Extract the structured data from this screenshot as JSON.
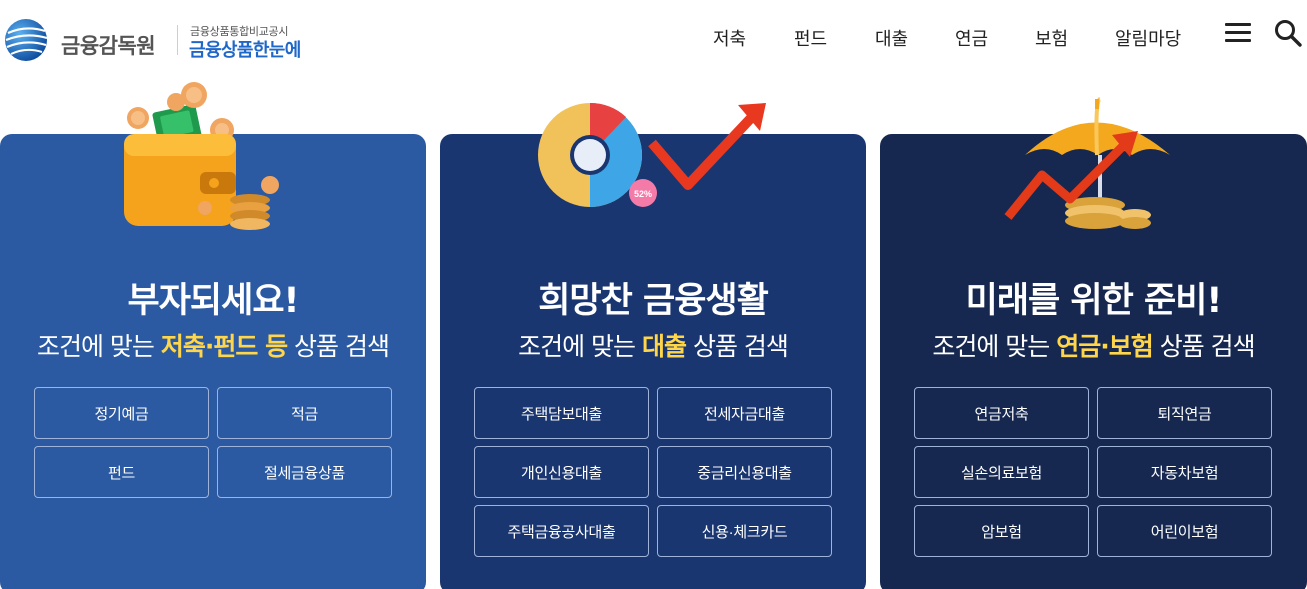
{
  "header": {
    "logo_main": "금융감독원",
    "logo_sub_top": "금융상품통합비교공시",
    "logo_sub_main": "금융상품한눈에",
    "nav": [
      "저축",
      "펀드",
      "대출",
      "연금",
      "보험",
      "알림마당"
    ]
  },
  "cards": [
    {
      "title": "부자되세요!",
      "sub_prefix": "조건에 맞는 ",
      "sub_highlight": "저축·펀드 등",
      "sub_suffix": " 상품 검색",
      "buttons": [
        "정기예금",
        "적금",
        "펀드",
        "절세금융상품"
      ]
    },
    {
      "title": "희망찬 금융생활",
      "sub_prefix": "조건에 맞는 ",
      "sub_highlight": "대출",
      "sub_suffix": " 상품 검색",
      "buttons": [
        "주택담보대출",
        "전세자금대출",
        "개인신용대출",
        "중금리신용대출",
        "주택금융공사대출",
        "신용·체크카드"
      ],
      "chart_badge": "52%"
    },
    {
      "title": "미래를 위한 준비!",
      "sub_prefix": "조건에 맞는 ",
      "sub_highlight": "연금·보험",
      "sub_suffix": " 상품 검색",
      "buttons": [
        "연금저축",
        "퇴직연금",
        "실손의료보험",
        "자동차보험",
        "암보험",
        "어린이보험"
      ]
    }
  ],
  "colors": {
    "card1_bg": "#2b5aa3",
    "card2_bg": "#1a3670",
    "card3_bg": "#162850",
    "highlight": "#ffd54a",
    "logo_blue": "#1f68c9"
  },
  "icons": [
    "menu-icon",
    "search-icon",
    "wallet-illustration",
    "pie-chart-illustration",
    "umbrella-illustration"
  ]
}
